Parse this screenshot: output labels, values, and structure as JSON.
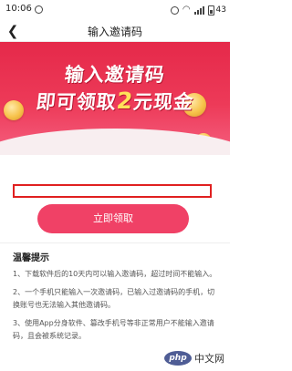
{
  "status_bar": {
    "time": "10:06",
    "battery": "43"
  },
  "nav": {
    "title": "输入邀请码",
    "back_icon": "chevron-left-icon"
  },
  "banner": {
    "line1": "输入邀请码",
    "line2_prefix": "即可领取",
    "line2_amount": "2",
    "line2_suffix": "元现金"
  },
  "invite_input": {
    "value": "",
    "placeholder": ""
  },
  "claim_button": {
    "label": "立即领取"
  },
  "tips": {
    "title": "温馨提示",
    "items": [
      "1、下载软件后的10天内可以输入邀请码，超过时间不能输入。",
      "2、一个手机只能输入一次邀请码，已输入过邀请码的手机，切换账号也无法输入其他邀请码。",
      "3、使用App分身软件、篡改手机号等非正常用户不能输入邀请码，且会被系统记录。"
    ]
  },
  "watermark": {
    "logo": "php",
    "text": "中文网"
  },
  "colors": {
    "brand": "#f04166",
    "banner_top": "#e5294a",
    "input_border": "#e02020",
    "amount": "#ffe15a"
  }
}
